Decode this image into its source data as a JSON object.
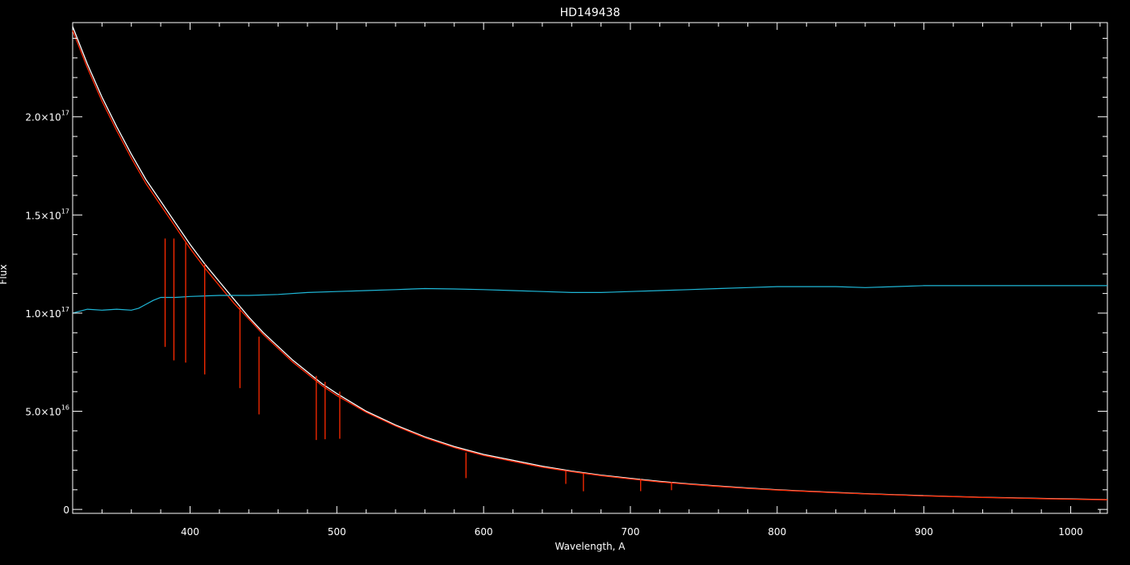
{
  "chart_data": {
    "type": "line",
    "title": "HD149438",
    "xlabel": "Wavelength, A",
    "ylabel": "Flux",
    "xlim": [
      320,
      1025
    ],
    "ylim": [
      -2000000000000000.0,
      2.48e+17
    ],
    "grid": false,
    "background": "#000000",
    "axis_color": "#ffffff",
    "x_ticks": [
      400,
      500,
      600,
      700,
      800,
      900,
      1000
    ],
    "x_tick_labels": [
      "400",
      "500",
      "600",
      "700",
      "800",
      "900",
      "1000"
    ],
    "y_ticks": [
      {
        "value": 0,
        "mantissa": "0",
        "exponent": ""
      },
      {
        "value": 5e+16,
        "mantissa": "5.0×10",
        "exponent": "16"
      },
      {
        "value": 1e+17,
        "mantissa": "1.0×10",
        "exponent": "17"
      },
      {
        "value": 1.5e+17,
        "mantissa": "1.5×10",
        "exponent": "17"
      },
      {
        "value": 2e+17,
        "mantissa": "2.0×10",
        "exponent": "17"
      }
    ],
    "series": [
      {
        "color": "#ffffff",
        "x": [
          320,
          330,
          340,
          350,
          360,
          370,
          380,
          390,
          400,
          410,
          420,
          430,
          440,
          450,
          460,
          470,
          480,
          490,
          500,
          520,
          540,
          560,
          580,
          600,
          620,
          640,
          660,
          680,
          700,
          720,
          740,
          760,
          780,
          800,
          820,
          840,
          860,
          880,
          900,
          920,
          940,
          960,
          980,
          1000,
          1025
        ],
        "y": [
          2.46e+17,
          2.27e+17,
          2.1e+17,
          1.95e+17,
          1.81e+17,
          1.68e+17,
          1.57e+17,
          1.46e+17,
          1.35e+17,
          1.25e+17,
          1.16e+17,
          1.07e+17,
          9.8e+16,
          9e+16,
          8.3e+16,
          7.6e+16,
          7e+16,
          6.4e+16,
          5.9e+16,
          5e+16,
          4.3e+16,
          3.7e+16,
          3.2e+16,
          2.8e+16,
          2.5e+16,
          2.2e+16,
          1.95e+16,
          1.75e+16,
          1.58e+16,
          1.43e+16,
          1.3e+16,
          1.19e+16,
          1.09e+16,
          1e+16,
          9300000000000000.0,
          8600000000000000.0,
          8000000000000000.0,
          7500000000000000.0,
          7000000000000000.0,
          6600000000000000.0,
          6200000000000000.0,
          5900000000000000.0,
          5600000000000000.0,
          5300000000000000.0,
          5000000000000000.0
        ]
      },
      {
        "color": "#ff2a00",
        "x": [
          320,
          330,
          340,
          350,
          360,
          370,
          380,
          390,
          400,
          410,
          420,
          430,
          440,
          450,
          460,
          470,
          480,
          490,
          500,
          520,
          540,
          560,
          580,
          600,
          620,
          640,
          660,
          680,
          700,
          720,
          740,
          760,
          780,
          800,
          820,
          840,
          860,
          880,
          900,
          920,
          940,
          960,
          980,
          1000,
          1025
        ],
        "y": [
          2.44e+17,
          2.25e+17,
          2.08e+17,
          1.93e+17,
          1.79e+17,
          1.66e+17,
          1.55e+17,
          1.44e+17,
          1.33e+17,
          1.23e+17,
          1.14e+17,
          1.05e+17,
          9.7e+16,
          8.9e+16,
          8.2e+16,
          7.5e+16,
          6.9e+16,
          6.3e+16,
          5.8e+16,
          4.95e+16,
          4.25e+16,
          3.65e+16,
          3.15e+16,
          2.75e+16,
          2.45e+16,
          2.15e+16,
          1.92e+16,
          1.72e+16,
          1.55e+16,
          1.4e+16,
          1.28e+16,
          1.17e+16,
          1.07e+16,
          9900000000000000.0,
          9200000000000000.0,
          8500000000000000.0,
          7900000000000000.0,
          7400000000000000.0,
          6900000000000000.0,
          6500000000000000.0,
          6100000000000000.0,
          5800000000000000.0,
          5500000000000000.0,
          5200000000000000.0,
          4900000000000000.0
        ]
      },
      {
        "color": "#1fb8d8",
        "x": [
          320,
          330,
          340,
          350,
          360,
          365,
          370,
          375,
          380,
          390,
          400,
          420,
          440,
          460,
          480,
          500,
          520,
          540,
          560,
          580,
          600,
          620,
          640,
          660,
          680,
          700,
          720,
          740,
          760,
          780,
          800,
          820,
          840,
          860,
          880,
          900,
          920,
          940,
          960,
          980,
          1000,
          1025
        ],
        "y": [
          1e+17,
          1.02e+17,
          1.015e+17,
          1.02e+17,
          1.015e+17,
          1.025e+17,
          1.045e+17,
          1.065e+17,
          1.08e+17,
          1.08e+17,
          1.085e+17,
          1.09e+17,
          1.09e+17,
          1.095e+17,
          1.105e+17,
          1.11e+17,
          1.115e+17,
          1.12e+17,
          1.125e+17,
          1.123e+17,
          1.12e+17,
          1.115e+17,
          1.11e+17,
          1.105e+17,
          1.105e+17,
          1.11e+17,
          1.115e+17,
          1.12e+17,
          1.125e+17,
          1.13e+17,
          1.135e+17,
          1.135e+17,
          1.135e+17,
          1.13e+17,
          1.135e+17,
          1.14e+17,
          1.14e+17,
          1.14e+17,
          1.14e+17,
          1.14e+17,
          1.14e+17,
          1.14e+17
        ]
      }
    ],
    "absorption_lines": [
      {
        "x": 383,
        "y": 1.38e+17,
        "depth": 0.4
      },
      {
        "x": 389,
        "y": 1.38e+17,
        "depth": 0.45
      },
      {
        "x": 397,
        "y": 1.36e+17,
        "depth": 0.45
      },
      {
        "x": 410,
        "y": 1.25e+17,
        "depth": 0.45
      },
      {
        "x": 434,
        "y": 1.03e+17,
        "depth": 0.4
      },
      {
        "x": 447,
        "y": 8.8e+16,
        "depth": 0.45
      },
      {
        "x": 486,
        "y": 6.8e+16,
        "depth": 0.48
      },
      {
        "x": 492,
        "y": 6.5e+16,
        "depth": 0.45
      },
      {
        "x": 502,
        "y": 6e+16,
        "depth": 0.4
      },
      {
        "x": 588,
        "y": 2.9e+16,
        "depth": 0.45
      },
      {
        "x": 656,
        "y": 2e+16,
        "depth": 0.35
      },
      {
        "x": 668,
        "y": 1.85e+16,
        "depth": 0.5
      },
      {
        "x": 707,
        "y": 1.55e+16,
        "depth": 0.4
      },
      {
        "x": 728,
        "y": 1.4e+16,
        "depth": 0.3
      }
    ]
  }
}
